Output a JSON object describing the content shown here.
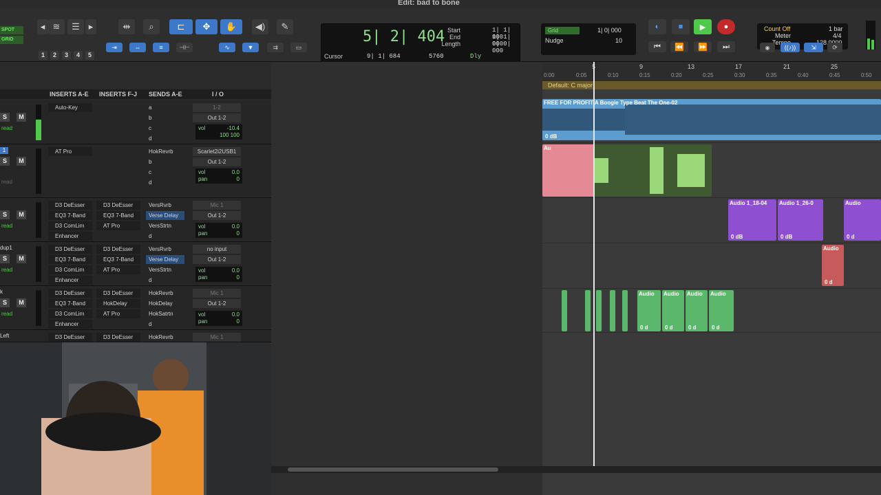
{
  "window": {
    "title": "Edit: bad to bone"
  },
  "toolbar": {
    "modes": [
      "SPOT",
      "GRID"
    ],
    "zoom_presets": [
      "1",
      "2",
      "3",
      "4",
      "5"
    ],
    "counter": {
      "main": "5| 2| 404",
      "start_label": "Start",
      "end_label": "End",
      "length_label": "Length",
      "start": "1| 1| 000",
      "end": "1| 1| 000",
      "length": "0| 0| 000",
      "cursor_label": "Cursor",
      "cursor": "9| 1| 684",
      "samples": "5760",
      "dly": "Dly"
    },
    "grid": {
      "label": "Grid",
      "value": "1| 0| 000",
      "nudge_label": "Nudge",
      "nudge_value": "10"
    },
    "tempo": {
      "count_off": "Count Off",
      "meter_label": "Meter",
      "meter": "4/4",
      "tempo_label": "Tempo",
      "tempo": "128.0000",
      "bar": "1 bar"
    }
  },
  "mixer": {
    "headers": [
      "INSERTS A-E",
      "INSERTS F-J",
      "SENDS A-E",
      "I / O"
    ],
    "tracks": [
      {
        "label": "",
        "insA": [
          "Auto-Key",
          "",
          "",
          ""
        ],
        "insF": [
          "",
          "",
          "",
          ""
        ],
        "sends": [
          "a",
          "b",
          "c",
          "d"
        ],
        "io": [
          "1-2",
          "Out 1-2"
        ],
        "vol": "-10.4",
        "pan": "100  100",
        "auto": "read"
      },
      {
        "label": "1",
        "insA": [
          "AT Pro",
          "",
          "",
          ""
        ],
        "insF": [
          "",
          "",
          "",
          ""
        ],
        "sends": [
          "HokRevrb",
          "b",
          "c",
          "d"
        ],
        "io": [
          "Scarlet2i2USB1",
          "Out 1-2"
        ],
        "vol": "0.0",
        "pan": "0",
        "auto": "read"
      },
      {
        "label": "",
        "insA": [
          "D3 DeEsser",
          "EQ3 7-Band",
          "D3 ComLim",
          "Enhancer"
        ],
        "insF": [
          "D3 DeEsser",
          "EQ3 7-Band",
          "AT Pro",
          ""
        ],
        "sends": [
          "VersRvrb",
          "Verse Delay",
          "VersStrtn",
          "d"
        ],
        "io": [
          "Mic 1",
          "Out 1-2"
        ],
        "vol": "0.0",
        "pan": "0",
        "auto": "read"
      },
      {
        "label": "dup1",
        "insA": [
          "D3 DeEsser",
          "EQ3 7-Band",
          "D3 ComLim",
          "Enhancer"
        ],
        "insF": [
          "D3 DeEsser",
          "EQ3 7-Band",
          "AT Pro",
          ""
        ],
        "sends": [
          "VersRvrb",
          "Verse Delay",
          "VersStrtn",
          "d"
        ],
        "io": [
          "no input",
          "Out 1-2"
        ],
        "vol": "0.0",
        "pan": "0",
        "auto": "read"
      },
      {
        "label": "k",
        "insA": [
          "D3 DeEsser",
          "EQ3 7-Band",
          "D3 ComLim",
          "Enhancer"
        ],
        "insF": [
          "D3 DeEsser",
          "HokDelay",
          "AT Pro",
          ""
        ],
        "sends": [
          "HokRevrb",
          "HokDelay",
          "HokSatrtn",
          "d"
        ],
        "io": [
          "Mic 1",
          "Out 1-2"
        ],
        "vol": "0.0",
        "pan": "0",
        "auto": "read"
      },
      {
        "label": "Left",
        "insA": [
          "D3 DeEsser"
        ],
        "insF": [
          "D3 DeEsser"
        ],
        "sends": [
          "HokRevrb"
        ],
        "io": [
          "Mic 1"
        ],
        "vol": "",
        "pan": "",
        "auto": ""
      }
    ]
  },
  "timeline": {
    "bars": [
      "5",
      "9",
      "13",
      "17",
      "21",
      "25"
    ],
    "seconds": [
      "0:00",
      "0:05",
      "0:10",
      "0:15",
      "0:20",
      "0:25",
      "0:30",
      "0:35",
      "0:40",
      "0:45",
      "0:50"
    ],
    "key_signature": "Default: C major",
    "clips": {
      "beat": {
        "name": "FREE FOR PROFIT A Boogie Type Beat The One-02",
        "gain": "0 dB"
      },
      "vocal": {
        "name": "Au"
      },
      "purple1": {
        "name": "Audio 1_18-04",
        "gain": "0 dB"
      },
      "purple2": {
        "name": "Audio 1_26-0",
        "gain": "0 dB"
      },
      "purple3": {
        "name": "Audio",
        "gain": "0 d"
      },
      "red": {
        "name": "Audio",
        "gain": "0 d"
      },
      "green": [
        {
          "name": "Audio",
          "gain": "0 d"
        },
        {
          "name": "Audio",
          "gain": "0 d"
        },
        {
          "name": "Audio",
          "gain": "0 d"
        },
        {
          "name": "Audio",
          "gain": "0 d"
        }
      ]
    }
  }
}
